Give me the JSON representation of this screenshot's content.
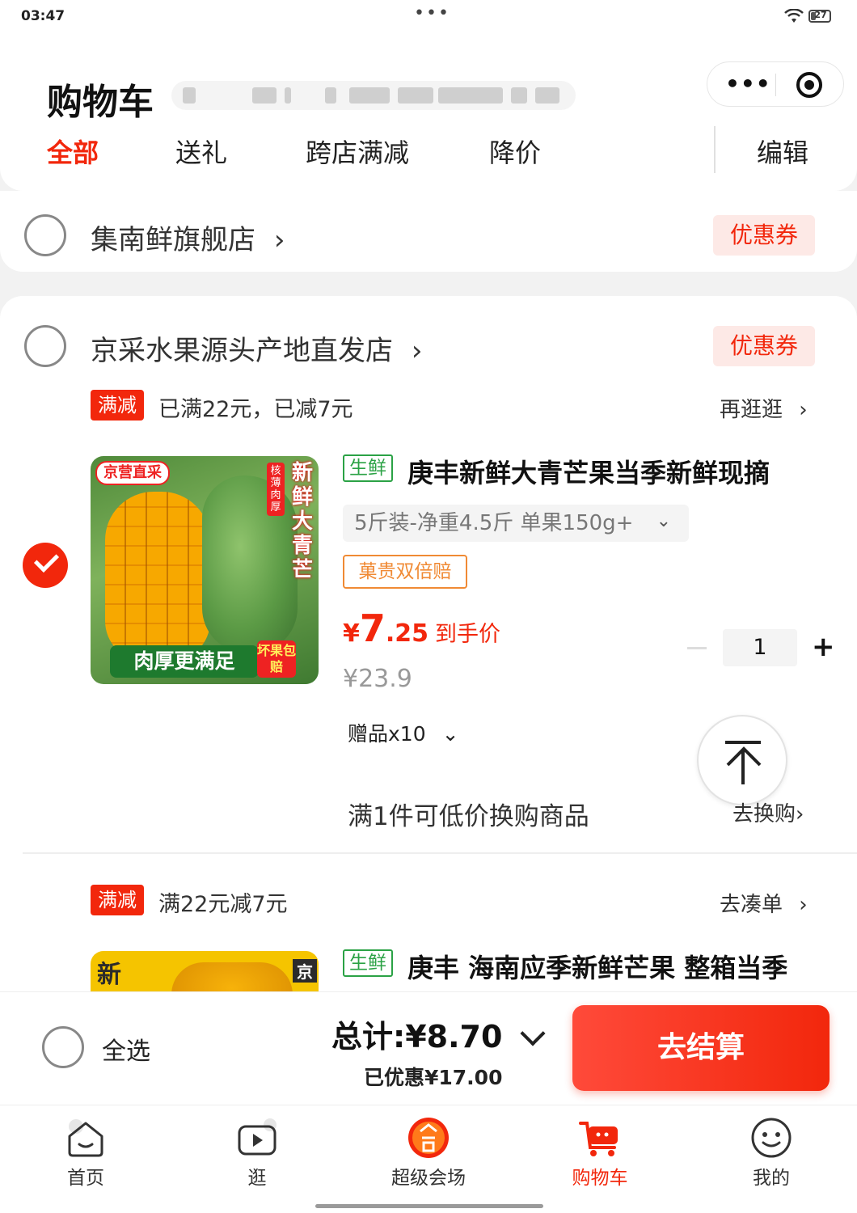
{
  "status_bar": {
    "time": "03:47",
    "dots": "•••",
    "battery": "27"
  },
  "header": {
    "title": "购物车",
    "capsule_more": "•••"
  },
  "tabs": [
    {
      "label": "全部",
      "active": true
    },
    {
      "label": "送礼"
    },
    {
      "label": "跨店满减"
    },
    {
      "label": "降价"
    }
  ],
  "edit_label": "编辑",
  "stores": [
    {
      "name": "集南鲜旗舰店",
      "chevron": "›",
      "coupon": "优惠券"
    },
    {
      "name": "京采水果源头产地直发店",
      "chevron": "›",
      "coupon": "优惠券"
    }
  ],
  "promo1": {
    "tag": "满减",
    "text": "已满22元，已减7元",
    "link": "再逛逛",
    "chevron": "›"
  },
  "product1": {
    "fresh_tag": "生鲜",
    "title": "庚丰新鲜大青芒果当季新鲜现摘",
    "spec": "5斤装-净重4.5斤 单果150g+",
    "spec_chevron": "⌄",
    "guarantee": "菓贵双倍赔",
    "price_currency": "¥",
    "price_int": "7",
    "price_dec": ".25",
    "price_label": "到手价",
    "original_price": "¥23.9",
    "quantity": "1",
    "gift": "赠品x10",
    "gift_chevron": "⌄",
    "image_text": {
      "badge": "京营直采",
      "side": "新鲜大青芒",
      "side_small": "核薄肉厚",
      "bottom": "肉厚更满足",
      "bottom_tag": "坏果包赔"
    }
  },
  "exchange": {
    "text": "满1件可低价换购商品",
    "link": "去换购",
    "chevron": "›"
  },
  "promo2": {
    "tag": "满减",
    "text": "满22元减7元",
    "link": "去凑单",
    "chevron": "›"
  },
  "product2": {
    "fresh_tag": "生鲜",
    "title": "庚丰 海南应季新鲜芒果 整箱当季",
    "image_text": {
      "left": "新",
      "side": "京"
    }
  },
  "checkout": {
    "select_all": "全选",
    "total_label": "总计:",
    "total_value": "¥8.70",
    "saved": "已优惠¥17.00",
    "button": "去结算"
  },
  "nav": [
    {
      "label": "首页",
      "icon": "home-icon"
    },
    {
      "label": "逛",
      "icon": "video-icon"
    },
    {
      "label": "超级会场",
      "icon": "super-venue-icon"
    },
    {
      "label": "购物车",
      "icon": "cart-icon",
      "active": true
    },
    {
      "label": "我的",
      "icon": "profile-icon"
    }
  ],
  "colors": {
    "accent": "#f2270c",
    "fresh": "#2ba245",
    "guarantee": "#f08a34"
  }
}
